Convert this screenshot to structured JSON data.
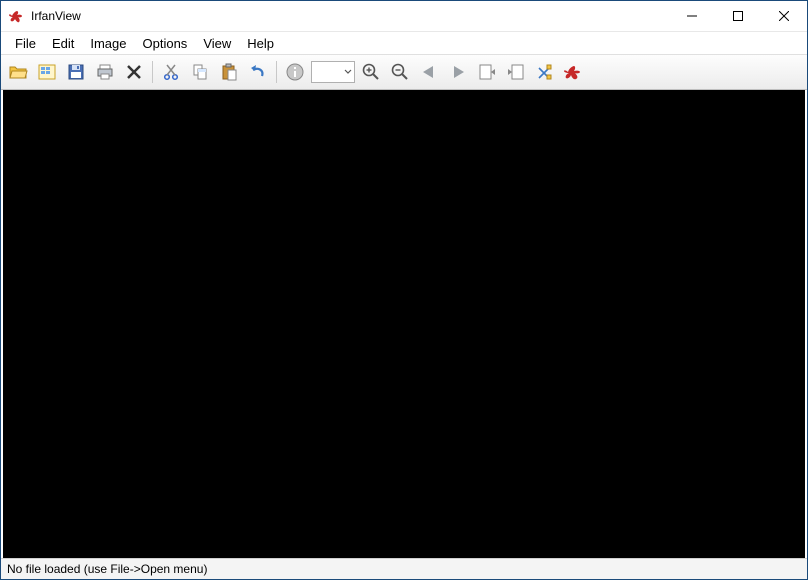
{
  "window": {
    "title": "IrfanView"
  },
  "menu": {
    "file": "File",
    "edit": "Edit",
    "image": "Image",
    "options": "Options",
    "view": "View",
    "help": "Help"
  },
  "toolbar": {
    "icons": {
      "open": "open-icon",
      "thumbnails": "thumbnails-icon",
      "save": "save-icon",
      "print": "print-icon",
      "delete": "delete-icon",
      "cut": "cut-icon",
      "copy": "copy-icon",
      "paste": "paste-icon",
      "undo": "undo-icon",
      "info": "info-icon",
      "zoom_in": "zoom-in-icon",
      "zoom_out": "zoom-out-icon",
      "prev": "previous-icon",
      "next": "next-icon",
      "prev_page": "previous-page-icon",
      "next_page": "next-page-icon",
      "settings": "settings-icon",
      "about": "about-icon"
    }
  },
  "statusbar": {
    "message": "No file loaded (use File->Open menu)"
  },
  "colors": {
    "accent_blue": "#4a8fd6",
    "folder_yellow": "#f3c横34a"
  }
}
